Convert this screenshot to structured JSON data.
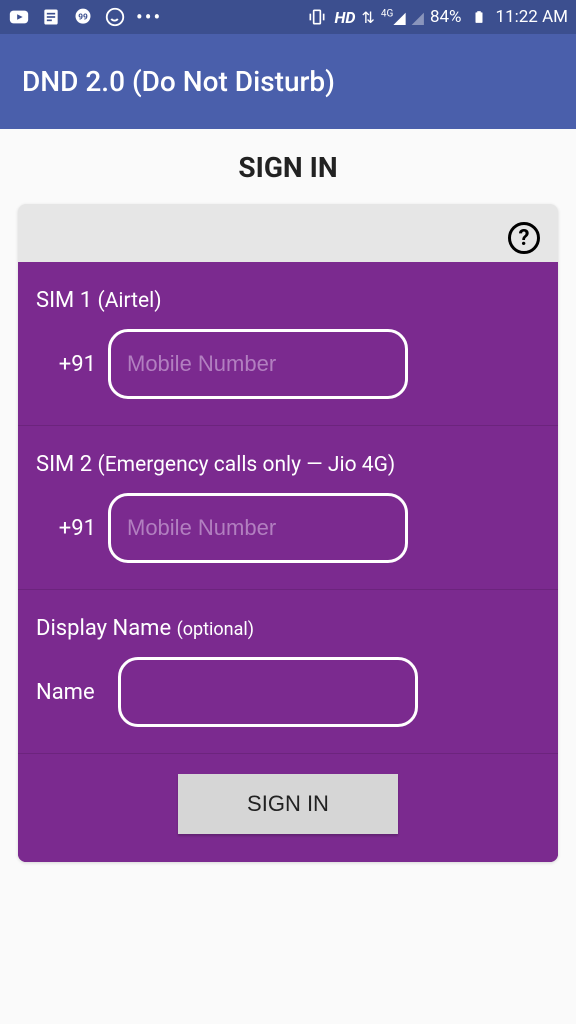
{
  "status": {
    "battery": "84%",
    "time": "11:22 AM",
    "hd": "HD",
    "net": "4G"
  },
  "app": {
    "title": "DND 2.0 (Do Not Disturb)"
  },
  "page": {
    "heading": "SIGN IN"
  },
  "help": {
    "symbol": "?"
  },
  "sim1": {
    "label": "SIM 1",
    "carrier": "(Airtel)",
    "prefix": "+91",
    "placeholder": "Mobile Number"
  },
  "sim2": {
    "label": "SIM 2",
    "carrier": "(Emergency calls only — Jio 4G)",
    "prefix": "+91",
    "placeholder": "Mobile Number"
  },
  "display_name": {
    "label": "Display Name",
    "hint": "(optional)",
    "field_label": "Name"
  },
  "actions": {
    "signin": "SIGN IN"
  }
}
